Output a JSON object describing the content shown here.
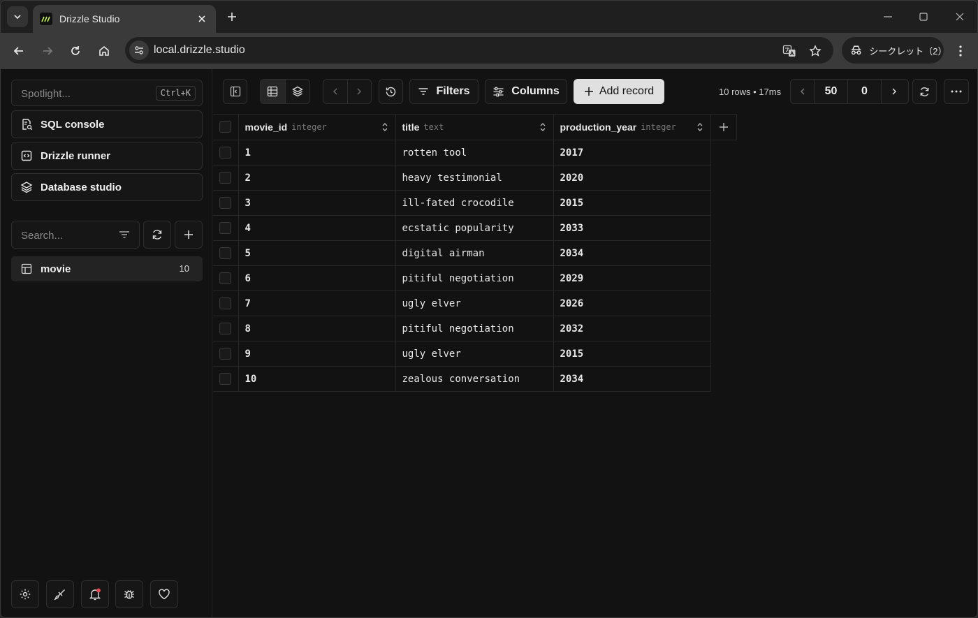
{
  "browser": {
    "tab_title": "Drizzle Studio",
    "url": "local.drizzle.studio",
    "incognito_label": "シークレット（2）"
  },
  "sidebar": {
    "spotlight_placeholder": "Spotlight...",
    "spotlight_shortcut": "Ctrl+K",
    "nav": [
      {
        "label": "SQL console",
        "icon": "sql-console-icon"
      },
      {
        "label": "Drizzle runner",
        "icon": "code-icon"
      },
      {
        "label": "Database studio",
        "icon": "layers-icon"
      }
    ],
    "search_placeholder": "Search...",
    "tables": [
      {
        "name": "movie",
        "count": "10"
      }
    ],
    "footer_icons": [
      "gear-icon",
      "brush-icon",
      "bell-icon",
      "bug-icon",
      "heart-icon"
    ]
  },
  "toolbar": {
    "filters_label": "Filters",
    "columns_label": "Columns",
    "add_record_label": "Add record",
    "row_info": "10 rows • 17ms",
    "limit": "50",
    "offset": "0"
  },
  "grid": {
    "columns": [
      {
        "name": "movie_id",
        "type": "integer"
      },
      {
        "name": "title",
        "type": "text"
      },
      {
        "name": "production_year",
        "type": "integer"
      }
    ],
    "rows": [
      [
        "1",
        "rotten tool",
        "2017"
      ],
      [
        "2",
        "heavy testimonial",
        "2020"
      ],
      [
        "3",
        "ill-fated crocodile",
        "2015"
      ],
      [
        "4",
        "ecstatic popularity",
        "2033"
      ],
      [
        "5",
        "digital airman",
        "2034"
      ],
      [
        "6",
        "pitiful negotiation",
        "2029"
      ],
      [
        "7",
        "ugly elver",
        "2026"
      ],
      [
        "8",
        "pitiful negotiation",
        "2032"
      ],
      [
        "9",
        "ugly elver",
        "2015"
      ],
      [
        "10",
        "zealous conversation",
        "2034"
      ]
    ]
  }
}
